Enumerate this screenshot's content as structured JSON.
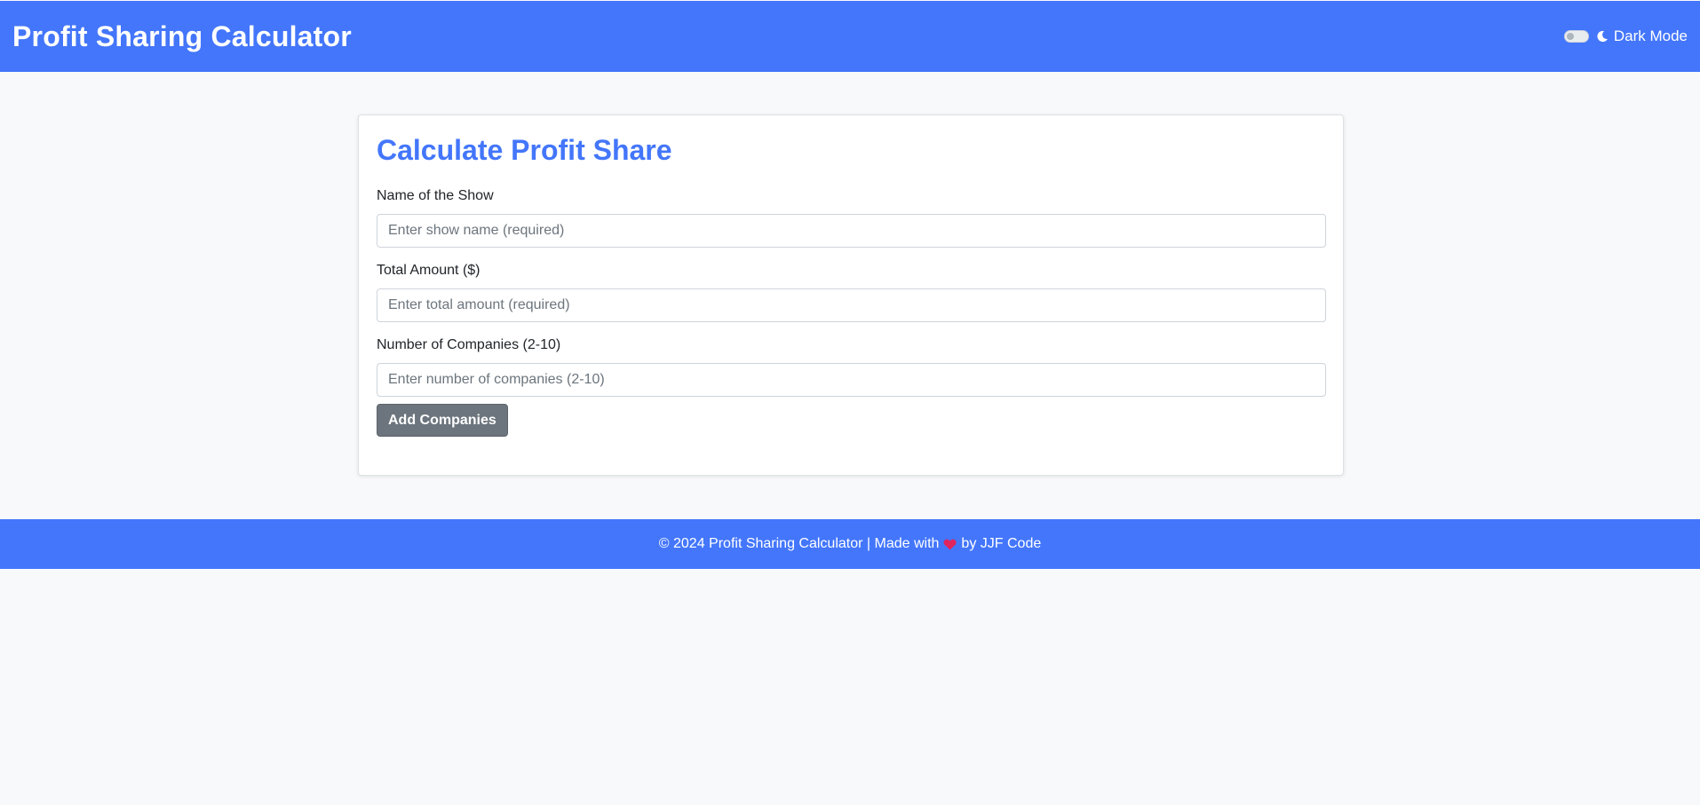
{
  "colors": {
    "brand": "#4376fb",
    "heart": "#e0245e",
    "button": "#6c757d"
  },
  "header": {
    "title": "Profit Sharing Calculator",
    "dark_mode_label": "Dark Mode",
    "dark_mode_on": false,
    "icons": [
      "toggle-switch",
      "moon-icon"
    ]
  },
  "form": {
    "title": "Calculate Profit Share",
    "fields": [
      {
        "label": "Name of the Show",
        "placeholder": "Enter show name (required)",
        "value": ""
      },
      {
        "label": "Total Amount ($)",
        "placeholder": "Enter total amount (required)",
        "value": ""
      },
      {
        "label": "Number of Companies (2-10)",
        "placeholder": "Enter number of companies (2-10)",
        "value": ""
      }
    ],
    "add_button_label": "Add Companies"
  },
  "footer": {
    "prefix": "© 2024 Profit Sharing Calculator | Made with",
    "icon": "heart-icon",
    "suffix": "by JJF Code"
  }
}
